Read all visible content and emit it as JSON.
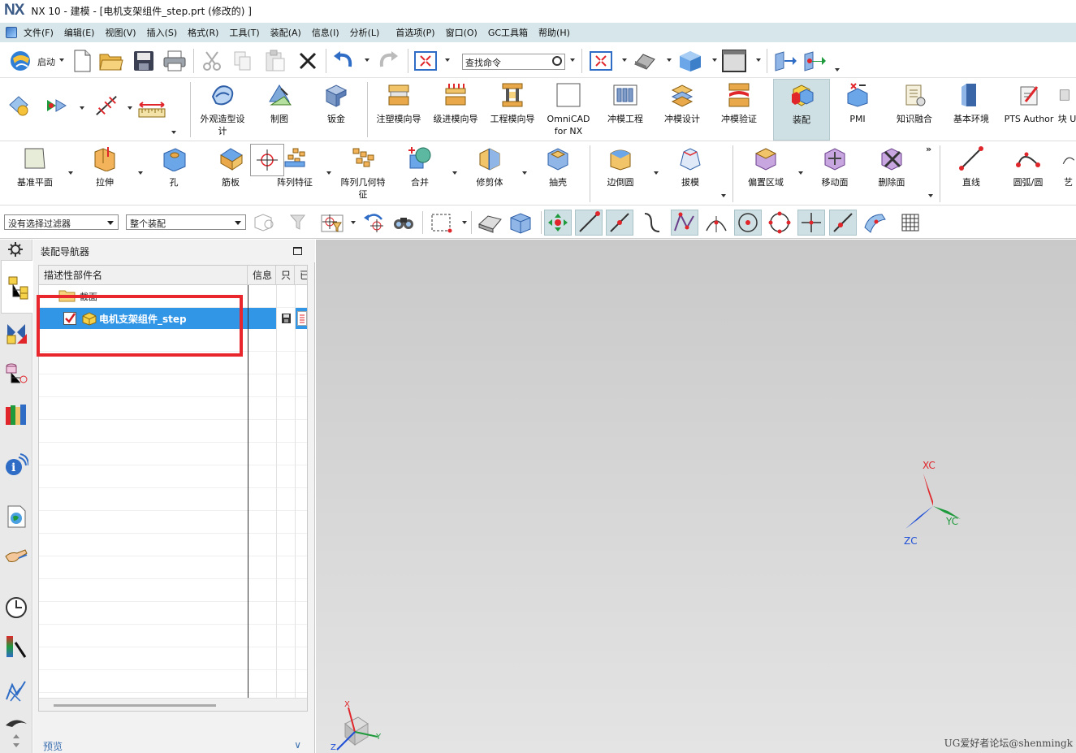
{
  "window": {
    "logo": "NX",
    "title": "NX 10 - 建模 - [电机支架组件_step.prt  (修改的) ]"
  },
  "menu": [
    "文件(F)",
    "编辑(E)",
    "视图(V)",
    "插入(S)",
    "格式(R)",
    "工具(T)",
    "装配(A)",
    "信息(I)",
    "分析(L)",
    "首选项(P)",
    "窗口(O)",
    "GC工具箱",
    "帮助(H)"
  ],
  "toolbar": {
    "start_label": "启动",
    "search_placeholder": "查找命令"
  },
  "ribbon_apps": [
    {
      "label": "外观造型设计"
    },
    {
      "label": "制图"
    },
    {
      "label": "钣金"
    },
    {
      "label": "注塑模向导"
    },
    {
      "label": "级进模向导"
    },
    {
      "label": "工程模向导"
    },
    {
      "label": "OmniCAD for NX"
    },
    {
      "label": "冲模工程"
    },
    {
      "label": "冲模设计"
    },
    {
      "label": "冲模验证"
    },
    {
      "label": "装配"
    },
    {
      "label": "PMI"
    },
    {
      "label": "知识融合"
    },
    {
      "label": "基本环境"
    },
    {
      "label": "PTS Author"
    },
    {
      "label": "块 U"
    }
  ],
  "ribbon_features": [
    {
      "label": "基准平面"
    },
    {
      "label": "拉伸"
    },
    {
      "label": "孔"
    },
    {
      "label": "筋板"
    },
    {
      "label": "阵列特征"
    },
    {
      "label": "阵列几何特征"
    },
    {
      "label": "合并"
    },
    {
      "label": "修剪体"
    },
    {
      "label": "抽壳"
    },
    {
      "label": "边倒圆"
    },
    {
      "label": "拔模"
    },
    {
      "label": "偏置区域"
    },
    {
      "label": "移动面"
    },
    {
      "label": "删除面"
    },
    {
      "label": "直线"
    },
    {
      "label": "圆弧/圆"
    },
    {
      "label": "艺"
    }
  ],
  "selection": {
    "filter": "没有选择过滤器",
    "scope": "整个装配"
  },
  "navigator": {
    "title": "装配导航器",
    "columns": [
      "描述性部件名",
      "信息",
      "只",
      "已"
    ],
    "section_label": "截面",
    "part_name": "电机支架组件_step",
    "preview_label": "预览"
  },
  "viewport": {
    "axes": {
      "x": "XC",
      "y": "YC",
      "z": "ZC"
    },
    "mini_axes": {
      "x": "X",
      "y": "Y",
      "z": "Z"
    },
    "watermark": "UG爱好者论坛@shenmingk"
  },
  "colors": {
    "menubar": "#d6e6ea",
    "selection": "#3296e6",
    "highlight_box": "#e8262b",
    "axis_x": "#e0262b",
    "axis_y": "#1e9a3c",
    "axis_z": "#1f4fd6"
  }
}
